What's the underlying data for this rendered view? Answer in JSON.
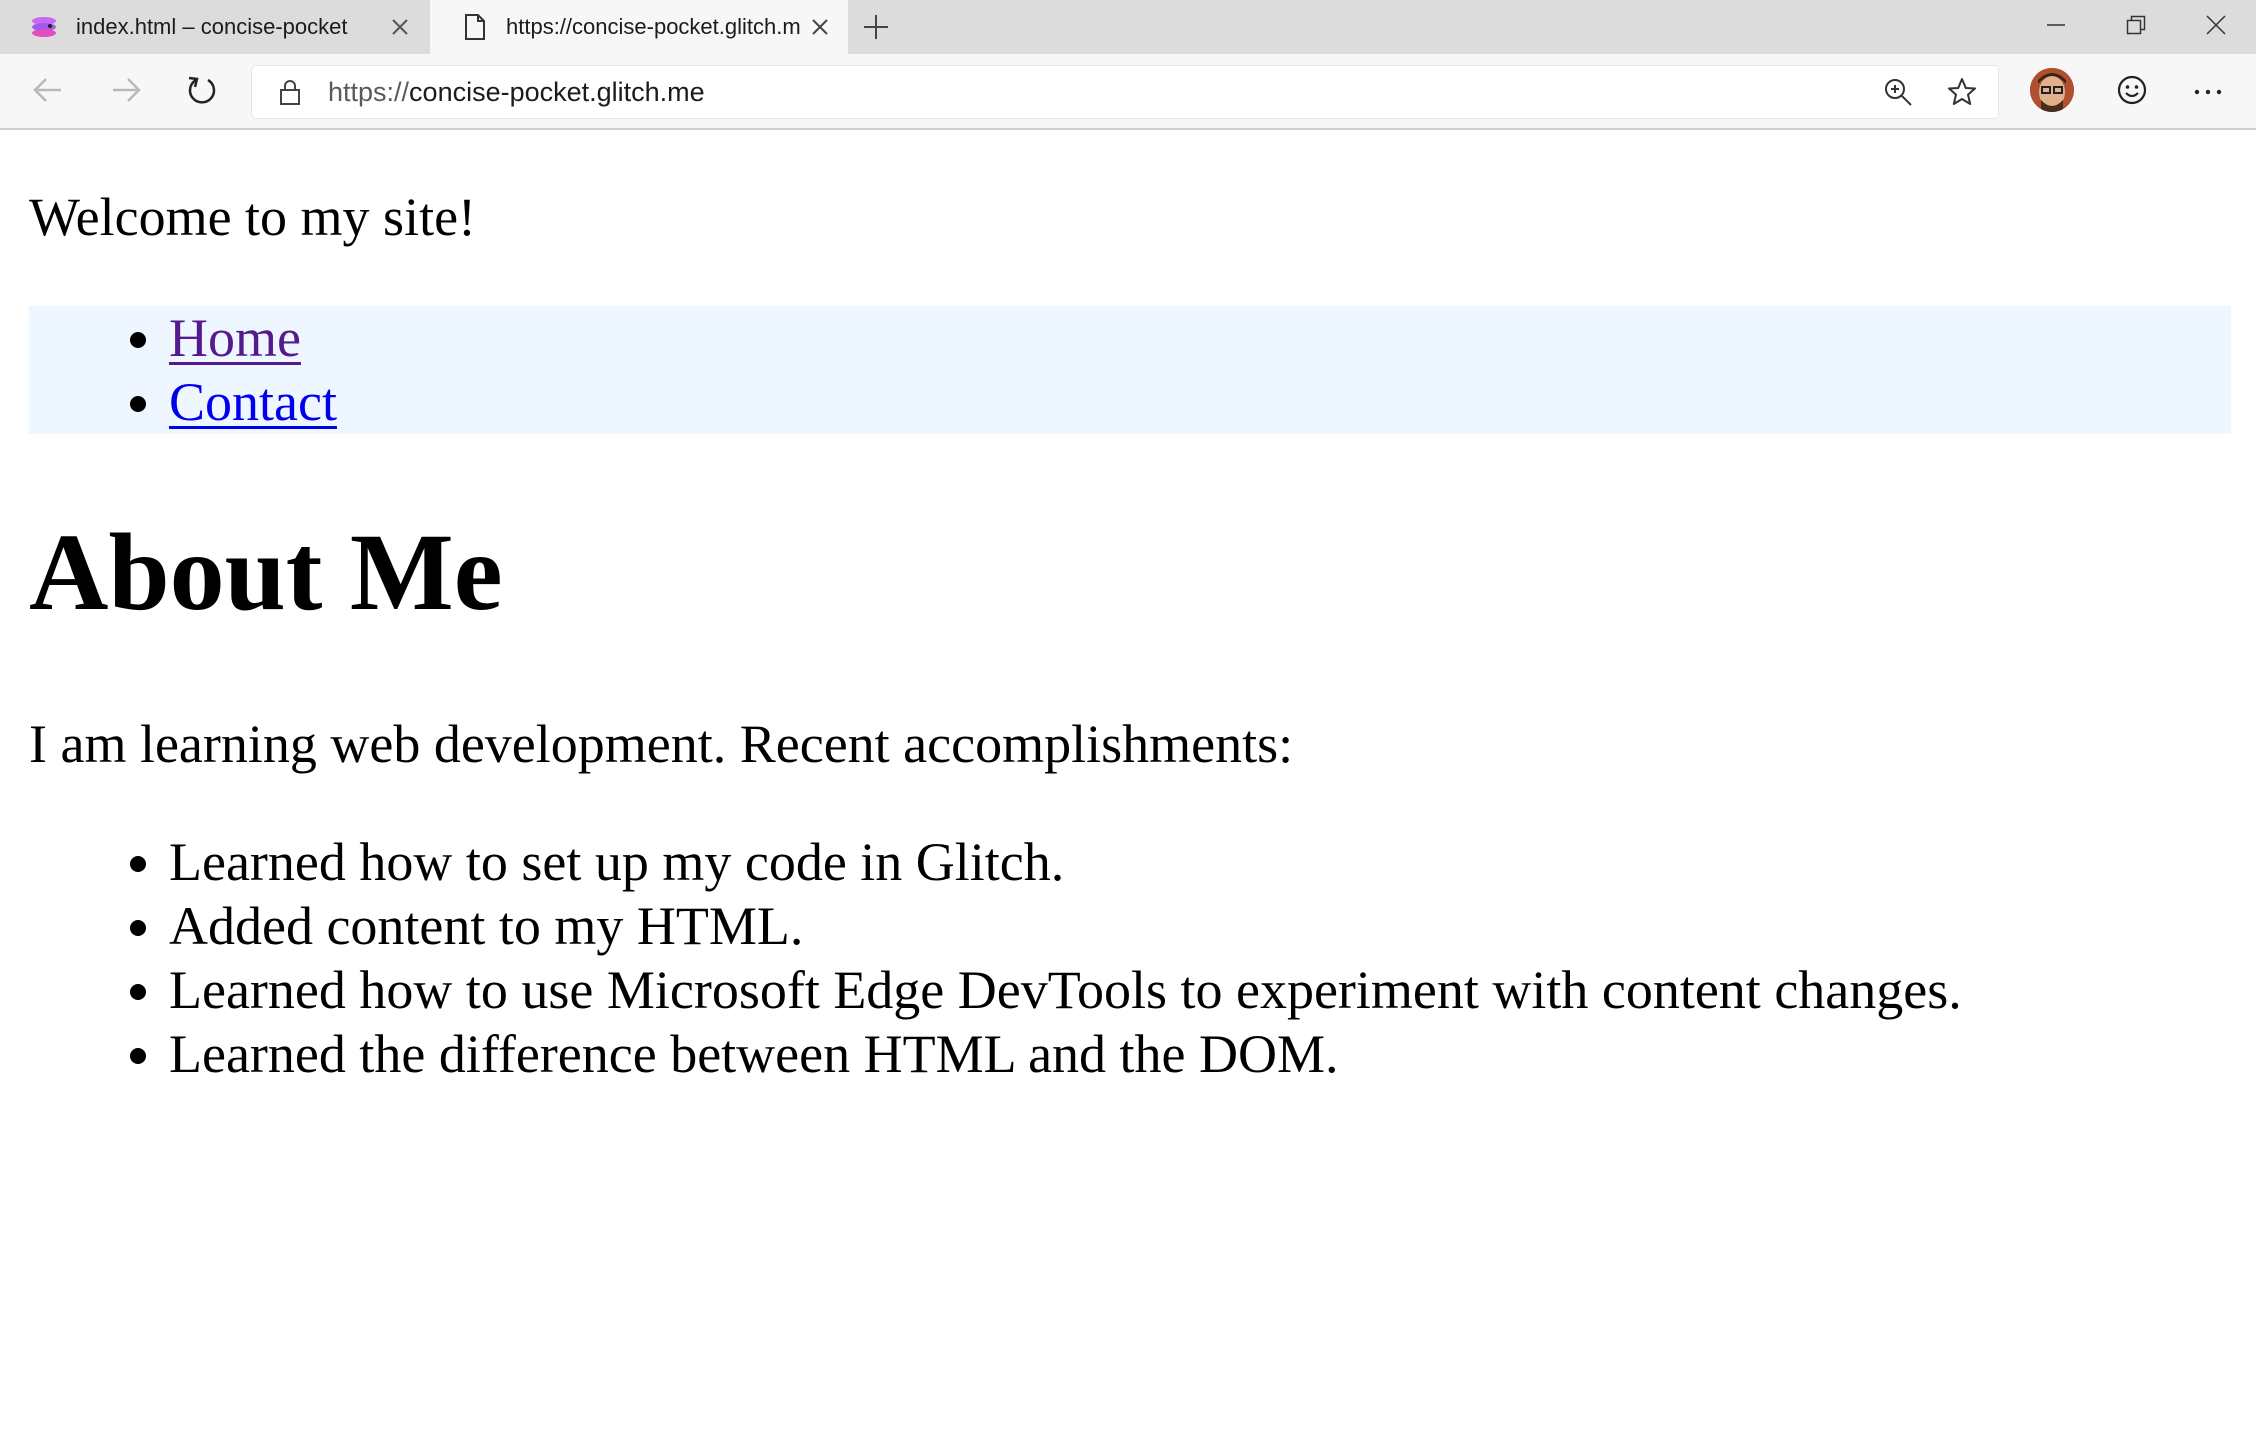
{
  "browser": {
    "tabs": [
      {
        "title": "index.html – concise-pocket",
        "active": false
      },
      {
        "title": "https://concise-pocket.glitch.me",
        "active": true
      }
    ],
    "address_bar": {
      "scheme": "https://",
      "host": "concise-pocket.glitch.me"
    },
    "icons": {
      "back": "back-arrow-icon",
      "forward": "forward-arrow-icon",
      "refresh": "refresh-icon",
      "lock": "lock-icon",
      "zoom": "zoom-in-icon",
      "favorite": "favorite-star-icon",
      "feedback": "smiley-icon",
      "menu": "more-icon"
    }
  },
  "page": {
    "welcome": "Welcome to my site!",
    "nav": [
      {
        "label": "Home",
        "visited": true
      },
      {
        "label": "Contact",
        "visited": false
      }
    ],
    "heading": "About Me",
    "intro": "I am learning web development. Recent accomplishments:",
    "accomplishments": [
      "Learned how to set up my code in Glitch.",
      "Added content to my HTML.",
      "Learned how to use Microsoft Edge DevTools to experiment with content changes.",
      "Learned the difference between HTML and the DOM."
    ]
  },
  "colors": {
    "nav_background": "#eef6ff",
    "visited_link": "#551a8b",
    "unvisited_link": "#0000ee",
    "tabstrip": "#dcdcdc",
    "toolbar": "#f7f7f7"
  }
}
